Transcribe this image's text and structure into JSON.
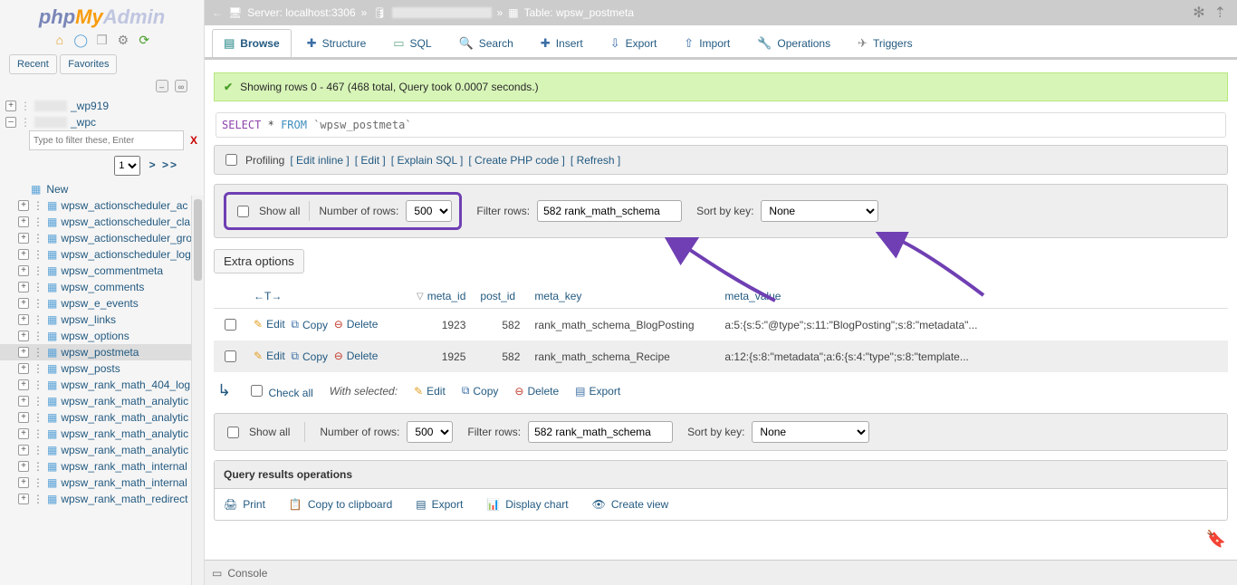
{
  "breadcrumbs": {
    "server_label": "Server: localhost:3306",
    "table_label": "Table: wpsw_postmeta"
  },
  "tabs": {
    "browse": "Browse",
    "structure": "Structure",
    "sql": "SQL",
    "search": "Search",
    "insert": "Insert",
    "export": "Export",
    "import": "Import",
    "operations": "Operations",
    "triggers": "Triggers"
  },
  "message": {
    "success": "Showing rows 0 - 467 (468 total, Query took 0.0007 seconds.)"
  },
  "sql": {
    "select": "SELECT",
    "star": "*",
    "from": "FROM",
    "table": "`wpsw_postmeta`"
  },
  "actions": {
    "profiling": "Profiling",
    "edit_inline": "Edit inline",
    "edit": "Edit",
    "explain": "Explain SQL",
    "createphp": "Create PHP code",
    "refresh": "Refresh"
  },
  "controls": {
    "show_all": "Show all",
    "num_rows_label": "Number of rows:",
    "num_rows_value": "500",
    "filter_label": "Filter rows:",
    "filter_value": "582 rank_math_schema",
    "sort_label": "Sort by key:",
    "sort_value": "None",
    "extra_options": "Extra options"
  },
  "columns": {
    "arrow": "←T→",
    "meta_id": "meta_id",
    "post_id": "post_id",
    "meta_key": "meta_key",
    "meta_value": "meta_value"
  },
  "rows": [
    {
      "meta_id": "1923",
      "post_id": "582",
      "meta_key": "rank_math_schema_BlogPosting",
      "meta_value": "a:5:{s:5:\"@type\";s:11:\"BlogPosting\";s:8:\"metadata\"..."
    },
    {
      "meta_id": "1925",
      "post_id": "582",
      "meta_key": "rank_math_schema_Recipe",
      "meta_value": "a:12:{s:8:\"metadata\";a:6:{s:4:\"type\";s:8:\"template..."
    }
  ],
  "row_actions": {
    "edit": "Edit",
    "copy": "Copy",
    "delete": "Delete"
  },
  "checkall": {
    "label": "Check all",
    "with_selected": "With selected:",
    "edit": "Edit",
    "copy": "Copy",
    "delete": "Delete",
    "export": "Export"
  },
  "qops": {
    "title": "Query results operations",
    "print": "Print",
    "clipboard": "Copy to clipboard",
    "export": "Export",
    "chart": "Display chart",
    "view": "Create view"
  },
  "console": {
    "label": "Console"
  },
  "nav": {
    "recent": "Recent",
    "favorites": "Favorites",
    "filter_placeholder": "Type to filter these, Enter",
    "page_value": "1",
    "more": "> >>",
    "db_suffix_1": "_wp919",
    "db_suffix_2": "_wpc",
    "new": "New",
    "tables": [
      "wpsw_actionscheduler_ac",
      "wpsw_actionscheduler_cla",
      "wpsw_actionscheduler_gro",
      "wpsw_actionscheduler_log",
      "wpsw_commentmeta",
      "wpsw_comments",
      "wpsw_e_events",
      "wpsw_links",
      "wpsw_options",
      "wpsw_postmeta",
      "wpsw_posts",
      "wpsw_rank_math_404_log",
      "wpsw_rank_math_analytic",
      "wpsw_rank_math_analytic",
      "wpsw_rank_math_analytic",
      "wpsw_rank_math_analytic",
      "wpsw_rank_math_internal",
      "wpsw_rank_math_internal",
      "wpsw_rank_math_redirect"
    ],
    "selected_table_index": 9
  }
}
